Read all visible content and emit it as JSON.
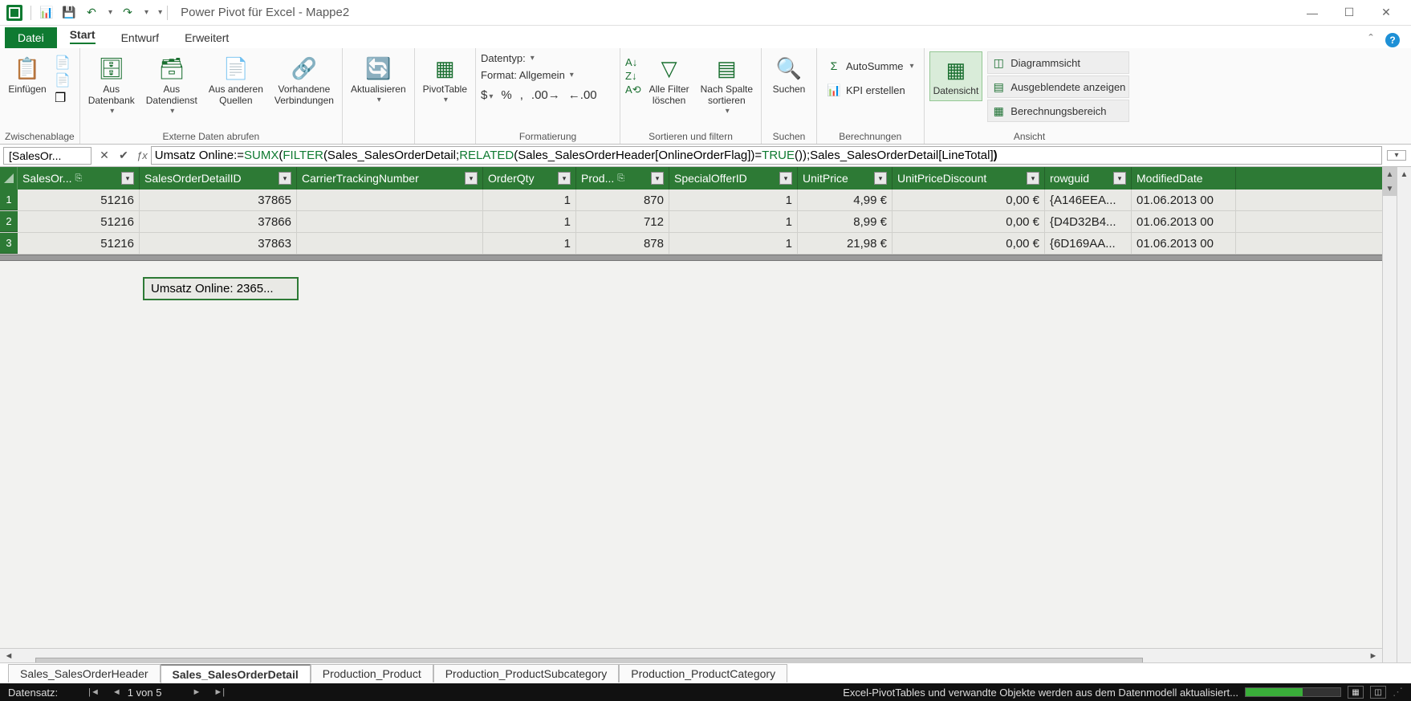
{
  "title": "Power Pivot für Excel - Mappe2",
  "qat": {
    "i1": "📊",
    "i2": "💾",
    "i3": "↶",
    "i4": "↷"
  },
  "tabs": {
    "file": "Datei",
    "start": "Start",
    "entwurf": "Entwurf",
    "erweitert": "Erweitert"
  },
  "ribbon": {
    "zwischen": {
      "einfuegen": "Einfügen",
      "label": "Zwischenablage"
    },
    "externe": {
      "db": "Aus\nDatenbank",
      "ds": "Aus\nDatendienst",
      "andere": "Aus anderen\nQuellen",
      "vorh": "Vorhandene\nVerbindungen",
      "label": "Externe Daten abrufen"
    },
    "aktual": {
      "btn": "Aktualisieren",
      "label": ""
    },
    "pivot": {
      "btn": "PivotTable",
      "label": ""
    },
    "format": {
      "datentyp": "Datentyp:",
      "format": "Format: Allgemein",
      "label": "Formatierung"
    },
    "sort": {
      "alle": "Alle Filter\nlöschen",
      "nach": "Nach Spalte\nsortieren",
      "label": "Sortieren und filtern"
    },
    "suchen": {
      "btn": "Suchen",
      "label": "Suchen"
    },
    "berech": {
      "auto": "AutoSumme",
      "kpi": "KPI erstellen",
      "label": "Berechnungen"
    },
    "ansicht": {
      "daten": "Datensicht",
      "diag": "Diagrammsicht",
      "ausgebl": "Ausgeblendete anzeigen",
      "berech": "Berechnungsbereich",
      "label": "Ansicht"
    }
  },
  "formula_bar": {
    "cellref": "[SalesOr...",
    "prefix": "Umsatz Online:=",
    "f1": "SUMX",
    "p1": "(",
    "f2": "FILTER",
    "p2": "(Sales_SalesOrderDetail; ",
    "f3": "RELATED",
    "p3": "(Sales_SalesOrderHeader[OnlineOrderFlag])=",
    "f4": "TRUE",
    "p4": "());Sales_SalesOrderDetail[LineTotal]",
    "p5": ")"
  },
  "columns": [
    "SalesOr...",
    "SalesOrderDetailID",
    "CarrierTrackingNumber",
    "OrderQty",
    "Prod...",
    "SpecialOfferID",
    "UnitPrice",
    "UnitPriceDiscount",
    "rowguid",
    "ModifiedDate"
  ],
  "rows": [
    {
      "n": "1",
      "c": [
        "51216",
        "37865",
        "",
        "1",
        "870",
        "1",
        "4,99 €",
        "0,00 €",
        "{A146EEA...",
        "01.06.2013 00"
      ]
    },
    {
      "n": "2",
      "c": [
        "51216",
        "37866",
        "",
        "1",
        "712",
        "1",
        "8,99 €",
        "0,00 €",
        "{D4D32B4...",
        "01.06.2013 00"
      ]
    },
    {
      "n": "3",
      "c": [
        "51216",
        "37863",
        "",
        "1",
        "878",
        "1",
        "21,98 €",
        "0,00 €",
        "{6D169AA...",
        "01.06.2013 00"
      ]
    }
  ],
  "calc_cell": "Umsatz Online: 2365...",
  "sheets": [
    "Sales_SalesOrderHeader",
    "Sales_SalesOrderDetail",
    "Production_Product",
    "Production_ProductSubcategory",
    "Production_ProductCategory"
  ],
  "status": {
    "datensatz": "Datensatz:",
    "pos": "1 von 5",
    "msg": "Excel-PivotTables und verwandte Objekte werden aus dem Datenmodell aktualisiert..."
  }
}
